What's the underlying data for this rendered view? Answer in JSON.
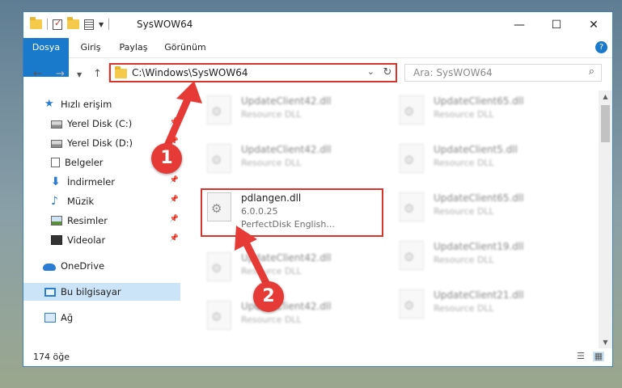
{
  "window": {
    "title": "SysWOW64",
    "controls": {
      "minimize": "—",
      "maximize": "☐",
      "close": "✕"
    }
  },
  "ribbon": {
    "tabs": [
      "Dosya",
      "Giriş",
      "Paylaş",
      "Görünüm"
    ],
    "help": "?"
  },
  "address_bar": {
    "path": "C:\\Windows\\SysWOW64",
    "search_placeholder": "Ara: SysWOW64"
  },
  "nav_pane": {
    "items": [
      {
        "label": "Hızlı erişim",
        "icon": "star-icon"
      },
      {
        "label": "Yerel Disk (C:)",
        "icon": "disk-icon",
        "pinned": true
      },
      {
        "label": "Yerel Disk (D:)",
        "icon": "disk-icon",
        "pinned": true
      },
      {
        "label": "Belgeler",
        "icon": "documents-icon",
        "pinned": true
      },
      {
        "label": "İndirmeler",
        "icon": "download-icon",
        "pinned": true
      },
      {
        "label": "Müzik",
        "icon": "music-icon",
        "pinned": true
      },
      {
        "label": "Resimler",
        "icon": "pictures-icon",
        "pinned": true
      },
      {
        "label": "Videolar",
        "icon": "videos-icon",
        "pinned": true
      },
      {
        "label": "OneDrive",
        "icon": "cloud-icon"
      },
      {
        "label": "Bu bilgisayar",
        "icon": "pc-icon",
        "selected": true
      },
      {
        "label": "Ağ",
        "icon": "network-icon"
      }
    ]
  },
  "files": {
    "left": [
      {
        "name": "UpdateClient42.dll",
        "type": "Resource DLL"
      },
      {
        "name": "UpdateClient42.dll",
        "type": "Resource DLL"
      },
      {
        "name": "pdlangen.dll",
        "version": "6.0.0.25",
        "description": "PerfectDisk English...",
        "highlighted": true
      },
      {
        "name": "UpdateClient42.dll",
        "type": "Resource DLL"
      },
      {
        "name": "UpdateClient42.dll",
        "type": "Resource DLL"
      }
    ],
    "right": [
      {
        "name": "UpdateClient65.dll",
        "type": "Resource DLL"
      },
      {
        "name": "UpdateClient5.dll",
        "type": "Resource DLL"
      },
      {
        "name": "UpdateClient65.dll",
        "type": "Resource DLL"
      },
      {
        "name": "UpdateClient19.dll",
        "type": "Resource DLL"
      },
      {
        "name": "UpdateClient21.dll",
        "type": "Resource DLL"
      }
    ]
  },
  "status_bar": {
    "count": "174 öğe"
  },
  "annotations": {
    "step1": "1",
    "step2": "2"
  },
  "colors": {
    "accent": "#1979ca",
    "highlight": "#d9342b",
    "badge": "#e53a35",
    "selection": "#cce4f7"
  }
}
